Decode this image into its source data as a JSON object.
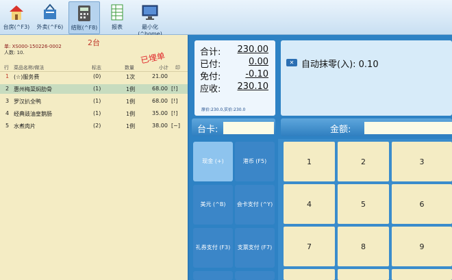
{
  "toolbar": {
    "items": [
      {
        "label": "台房(^F3)",
        "icon": "house-icon"
      },
      {
        "label": "外卖(^F6)",
        "icon": "basket-icon"
      },
      {
        "label": "结账(^F8)",
        "icon": "calculator-icon"
      },
      {
        "label": "报表",
        "icon": "spreadsheet-icon"
      },
      {
        "label": "最小化(^home)",
        "icon": "monitor-icon"
      }
    ]
  },
  "order": {
    "table_name": "2台",
    "order_no": "单: XS000-150226-0002",
    "persons": "人数: 10.",
    "stamp": "已埋单",
    "headers": [
      "行",
      "菜品名称/做法",
      "标志",
      "数量",
      "小计",
      "印"
    ],
    "rows": [
      {
        "no": "1",
        "name": "(☆)服务费",
        "flag": "(0)",
        "qty": "1次",
        "subtotal": "21.00",
        "print": ""
      },
      {
        "no": "2",
        "name": "惠州梅菜焖肋骨",
        "flag": "(1)",
        "qty": "1例",
        "subtotal": "68.00",
        "print": "[!]"
      },
      {
        "no": "3",
        "name": "罗汉扒全鸭",
        "flag": "(1)",
        "qty": "1例",
        "subtotal": "68.00",
        "print": "[!]"
      },
      {
        "no": "4",
        "name": "经典豉油皇鹅肠",
        "flag": "(1)",
        "qty": "1例",
        "subtotal": "35.00",
        "print": "[!]"
      },
      {
        "no": "5",
        "name": "水煮肉片",
        "flag": "(2)",
        "qty": "1例",
        "subtotal": "38.00",
        "print": "[~]"
      }
    ]
  },
  "summary": {
    "total_label": "合计:",
    "total": "230.00",
    "paid_label": "已付:",
    "paid": "0.00",
    "free_label": "免付:",
    "free": "-0.10",
    "due_label": "应收:",
    "due": "230.10",
    "note": "原价:230.0,实价:230.0"
  },
  "rounding": {
    "label": "自动抹零(入): 0.10"
  },
  "card": {
    "label": "台卡:",
    "value": ""
  },
  "amount": {
    "label": "金额:",
    "value": ""
  },
  "payments": [
    {
      "label": "现金 (+)"
    },
    {
      "label": "港币 (F5)"
    },
    {
      "label": "美元 (^B)"
    },
    {
      "label": "会卡支付 (^Y)"
    },
    {
      "label": "礼券支付 (F3)"
    },
    {
      "label": "支票支付 (F7)"
    }
  ],
  "keypad": [
    "1",
    "2",
    "3",
    "4",
    "5",
    "6",
    "7",
    "8",
    "9"
  ],
  "colors": {
    "accent": "#2e82c4",
    "panel": "#f4ecc4",
    "highlight": "#c7dcbf",
    "stamp": "#e0262a"
  }
}
